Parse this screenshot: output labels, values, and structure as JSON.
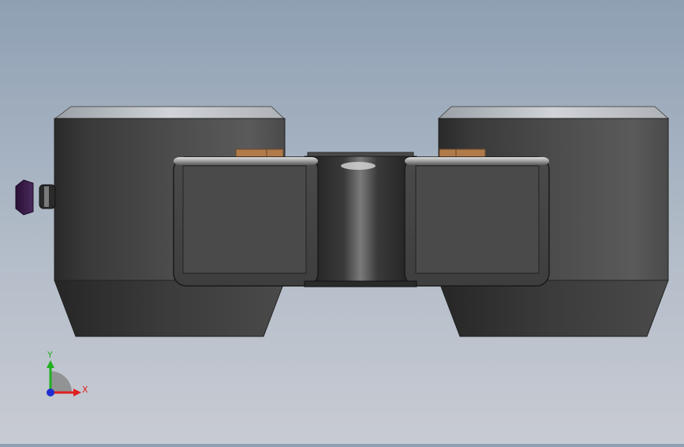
{
  "viewport": {
    "background_top": "#8fa0b4",
    "background_bottom": "#c8cbd3"
  },
  "model": {
    "body_color": "#3a3a3a",
    "cap_color": "#b8bcc0",
    "knob_color": "#3b1f4a",
    "accent_color": "#b07a4a"
  },
  "triad": {
    "x_label": "X",
    "y_label": "Y",
    "x_color": "#e02020",
    "y_color": "#20b020",
    "z_color": "#2030d0"
  }
}
